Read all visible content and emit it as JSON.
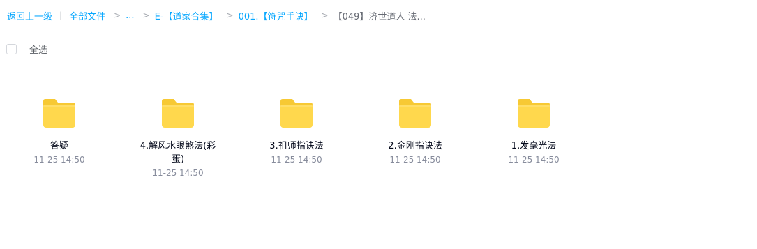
{
  "breadcrumb": {
    "back": "返回上一级",
    "all_files": "全部文件",
    "ellipsis": "...",
    "folder1": "E-【道家合集】",
    "folder2": "001.【符咒手诀】",
    "current": "【049】济世道人 法...",
    "pipe": "|",
    "separator": ">"
  },
  "select_all": {
    "label": "全选",
    "checked": false
  },
  "files": [
    {
      "name": "答疑",
      "time": "11-25 14:50",
      "icon": "folder-icon"
    },
    {
      "name": "4.解风水眼煞法(彩蛋)",
      "time": "11-25 14:50",
      "icon": "folder-icon"
    },
    {
      "name": "3.祖师指诀法",
      "time": "11-25 14:50",
      "icon": "folder-icon"
    },
    {
      "name": "2.金刚指诀法",
      "time": "11-25 14:50",
      "icon": "folder-icon"
    },
    {
      "name": "1.发毫光法",
      "time": "11-25 14:50",
      "icon": "folder-icon"
    }
  ],
  "colors": {
    "link": "#06a7ff",
    "folder_back": "#f7c934",
    "folder_front": "#ffd84d"
  }
}
